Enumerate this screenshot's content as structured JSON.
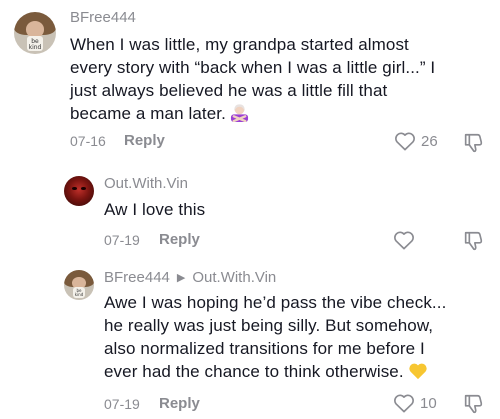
{
  "comments": [
    {
      "username": "BFree444",
      "lines": [
        "When I was little, my grandpa started almost",
        "every story with “back when I was a little girl...” I",
        "just always believed he was a little fill that",
        "became a man later."
      ],
      "emoji": "woman-gesturing-no-emoji",
      "date": "07-16",
      "reply_label": "Reply",
      "likes": "26"
    },
    {
      "username": "Out.With.Vin",
      "lines": [
        "Aw I love this"
      ],
      "date": "07-19",
      "reply_label": "Reply",
      "likes": ""
    },
    {
      "username": "BFree444",
      "reply_to": "Out.With.Vin",
      "lines": [
        "Awe I was hoping he’d pass the vibe check...",
        "he really was just being silly. But somehow,",
        "also normalized transitions for me before I",
        "ever had the chance to think otherwise."
      ],
      "emoji": "yellow-heart-emoji",
      "date": "07-19",
      "reply_label": "Reply",
      "likes": "10"
    }
  ],
  "avatar_text": "be kind",
  "colors": {
    "text": "#161823",
    "muted": "#8a8b91",
    "background": "#ffffff"
  }
}
